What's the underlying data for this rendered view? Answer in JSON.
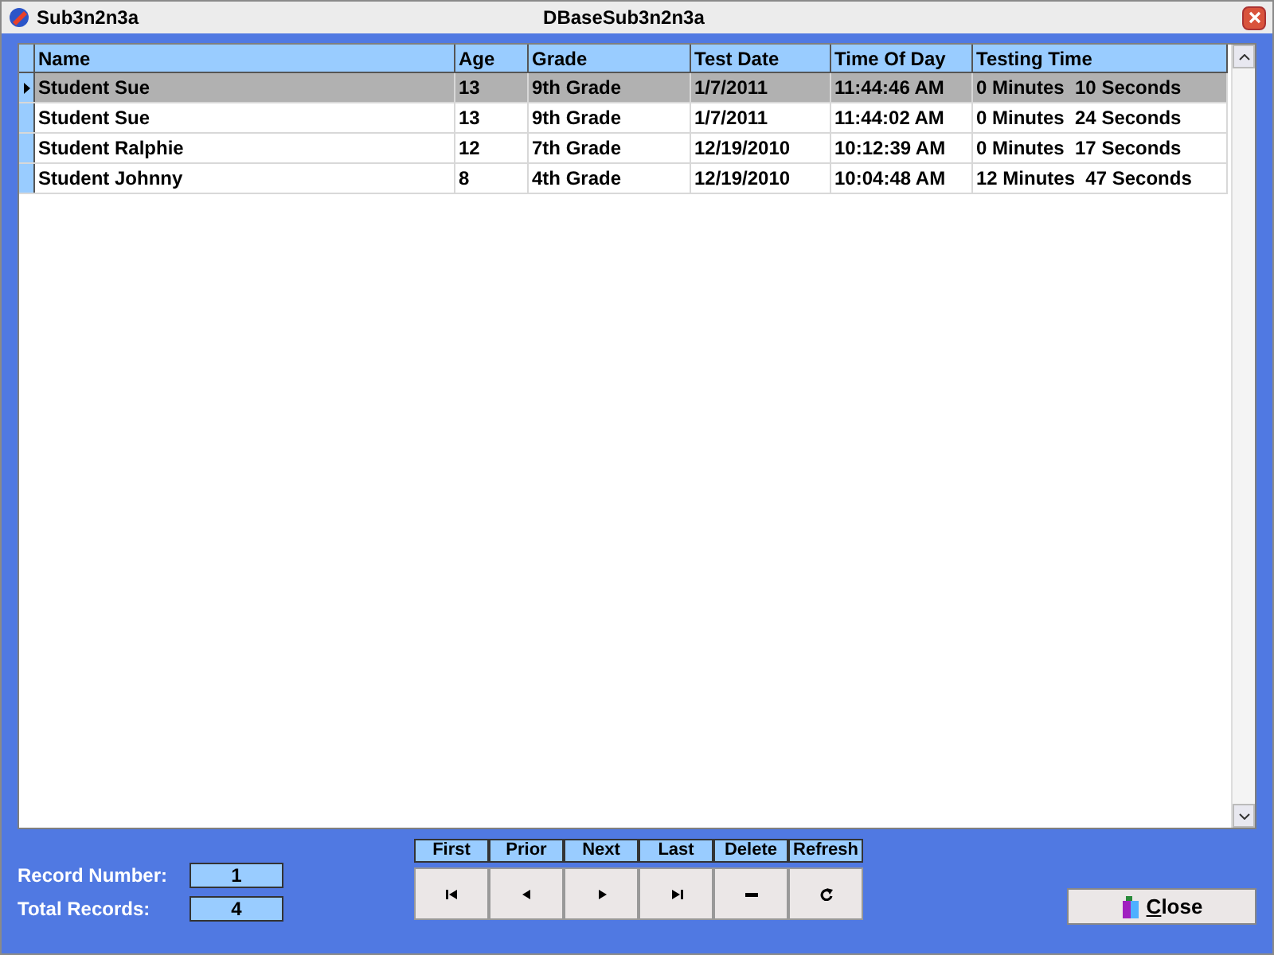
{
  "window": {
    "title": "Sub3n2n3a",
    "caption": "DBaseSub3n2n3a"
  },
  "table": {
    "columns": [
      "Name",
      "Age",
      "Grade",
      "Test Date",
      "Time Of Day",
      "Testing Time"
    ],
    "rows": [
      {
        "selected": true,
        "cells": [
          "Student Sue",
          "13",
          "9th Grade",
          "1/7/2011",
          "11:44:46 AM",
          "0 Minutes  10 Seconds"
        ]
      },
      {
        "selected": false,
        "cells": [
          "Student Sue",
          "13",
          "9th Grade",
          "1/7/2011",
          "11:44:02 AM",
          "0 Minutes  24 Seconds"
        ]
      },
      {
        "selected": false,
        "cells": [
          "Student Ralphie",
          "12",
          "7th Grade",
          "12/19/2010",
          "10:12:39 AM",
          "0 Minutes  17 Seconds"
        ]
      },
      {
        "selected": false,
        "cells": [
          "Student Johnny",
          "8",
          "4th Grade",
          "12/19/2010",
          "10:04:48 AM",
          "12 Minutes  47 Seconds"
        ]
      }
    ]
  },
  "record_number": {
    "label": "Record Number:",
    "value": "1"
  },
  "total_records": {
    "label": "Total Records:",
    "value": "4"
  },
  "navigator": [
    {
      "label": "First",
      "kind": "first"
    },
    {
      "label": "Prior",
      "kind": "prior"
    },
    {
      "label": "Next",
      "kind": "next"
    },
    {
      "label": "Last",
      "kind": "last"
    },
    {
      "label": "Delete",
      "kind": "delete"
    },
    {
      "label": "Refresh",
      "kind": "refresh"
    }
  ],
  "close_button": {
    "label": "Close"
  }
}
